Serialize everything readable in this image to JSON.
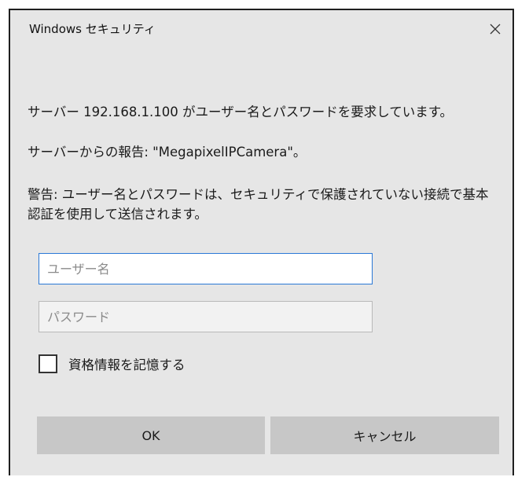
{
  "window": {
    "title": "Windows セキュリティ",
    "close_icon": "close-icon"
  },
  "messages": {
    "request": "サーバー 192.168.1.100 がユーザー名とパスワードを要求しています。",
    "report": "サーバーからの報告: \"MegapixelIPCamera\"。",
    "warning": "警告: ユーザー名とパスワードは、セキュリティで保護されていない接続で基本\n認証を使用して送信されます。"
  },
  "form": {
    "username": {
      "placeholder": "ユーザー名",
      "value": ""
    },
    "password": {
      "placeholder": "パスワード",
      "value": ""
    },
    "remember": {
      "label": "資格情報を記憶する",
      "checked": false
    }
  },
  "buttons": {
    "ok": "OK",
    "cancel": "キャンセル"
  }
}
